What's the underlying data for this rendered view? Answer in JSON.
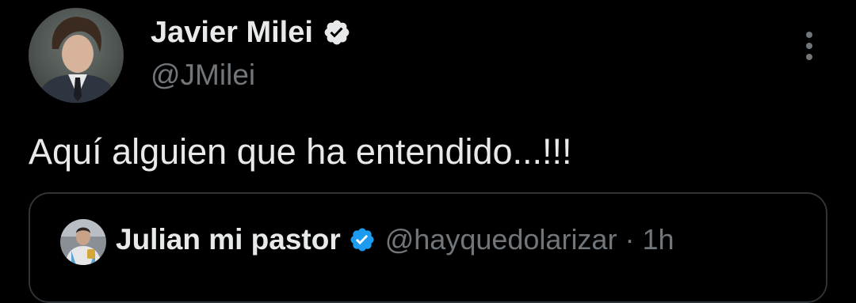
{
  "author": {
    "display_name": "Javier Milei",
    "handle": "@JMilei",
    "verified_color": "#1d9bf0"
  },
  "tweet": {
    "text": "Aquí alguien que ha entendido...!!!"
  },
  "quoted": {
    "display_name": "Julian mi pastor",
    "handle": "@hayquedolarizar",
    "separator": "·",
    "time": "1h",
    "verified_color": "#1d9bf0"
  },
  "icons": {
    "author_verified": "verified-badge-icon",
    "quoted_verified": "verified-badge-icon",
    "more": "more-options-icon"
  },
  "colors": {
    "background": "#000000",
    "primary_text": "#e7e9ea",
    "secondary_text": "#71767b",
    "border": "#2f3336"
  }
}
